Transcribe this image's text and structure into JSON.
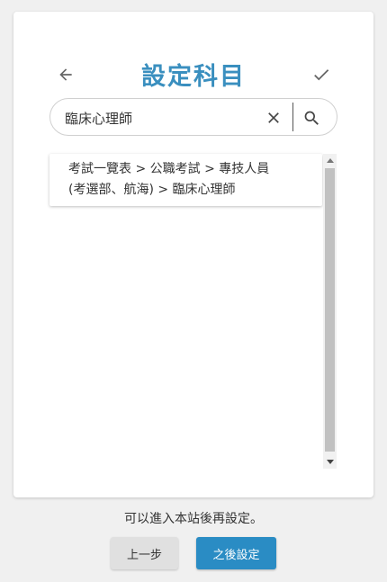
{
  "header": {
    "title": "設定科目",
    "back_icon": "arrow-left-icon",
    "confirm_icon": "check-icon"
  },
  "search": {
    "value": "臨床心理師",
    "clear_icon": "close-icon",
    "search_icon": "search-icon"
  },
  "results": [
    {
      "line1": "考試一覽表 > 公職考試 > 專技人員",
      "line2": "(考選部、航海) > 臨床心理師"
    }
  ],
  "footer": {
    "note": "可以進入本站後再設定。",
    "prev_label": "上一步",
    "later_label": "之後設定"
  },
  "colors": {
    "accent": "#3a8fbf",
    "button_primary": "#2a8cc4",
    "icon": "#666666",
    "background": "#f0f0f0"
  }
}
